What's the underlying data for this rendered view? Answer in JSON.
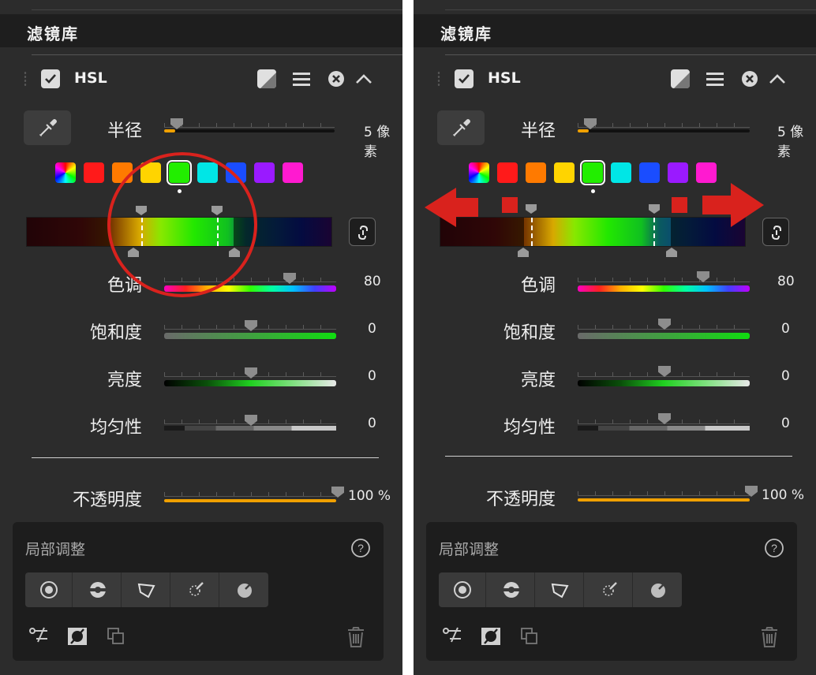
{
  "header": {
    "title": "滤镜库"
  },
  "filter": {
    "name": "HSL"
  },
  "radius": {
    "label": "半径",
    "value": "5 像素"
  },
  "sliders": {
    "hue_label": "色调",
    "saturation_label": "饱和度",
    "brightness_label": "亮度",
    "uniformity_label": "均匀性",
    "opacity_label": "不透明度"
  },
  "left_values": {
    "hue": "80",
    "saturation": "0",
    "brightness": "0",
    "uniformity": "0",
    "opacity": "100 %"
  },
  "right_values": {
    "hue": "80",
    "saturation": "0",
    "brightness": "0",
    "uniformity": "0",
    "opacity": "100 %"
  },
  "swatches": [
    {
      "name": "all-colors",
      "color": "conic"
    },
    {
      "name": "red",
      "color": "#ff1a1a"
    },
    {
      "name": "orange",
      "color": "#ff7a00"
    },
    {
      "name": "yellow",
      "color": "#ffd400"
    },
    {
      "name": "green",
      "color": "#22ee00",
      "selected": true
    },
    {
      "name": "cyan",
      "color": "#00e6e6"
    },
    {
      "name": "blue",
      "color": "#1a4dff"
    },
    {
      "name": "purple",
      "color": "#9a1aff"
    },
    {
      "name": "magenta",
      "color": "#ff1ad0"
    }
  ],
  "local_adjust": {
    "title": "局部调整",
    "help": "?"
  },
  "icons": {
    "compare": "compare-icon",
    "menu": "hamburger-menu-icon",
    "close": "close-circle-icon",
    "collapse": "chevron-up-icon",
    "eyedropper": "eyedropper-icon",
    "link": "link-icon",
    "trash": "trash-icon"
  },
  "annotation_color": "#d9221d"
}
